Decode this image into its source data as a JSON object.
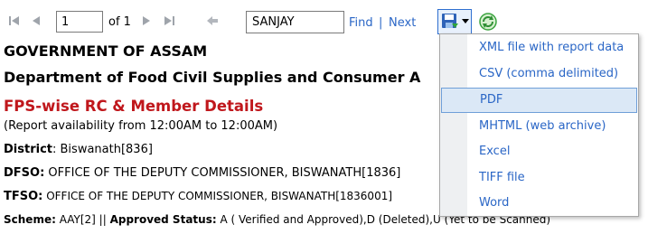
{
  "toolbar": {
    "page_value": "1",
    "of_text": "of 1",
    "search_value": "SANJAY",
    "find_label": "Find",
    "separator": "|",
    "next_label": "Next"
  },
  "report": {
    "title_line1": "GOVERNMENT OF ASSAM",
    "title_line2": "Department of Food  Civil Supplies and Consumer A",
    "report_title": "FPS-wise RC & Member Details",
    "availability": "(Report availability from 12:00AM to 12:00AM)",
    "district_label": "District",
    "district_value": ": Biswanath[836]",
    "dfso_label": "DFSO:",
    "dfso_value": " OFFICE OF THE DEPUTY COMMISSIONER, BISWANATH[1836]",
    "tfso_label": "TFSO:",
    "tfso_value": " OFFICE OF THE DEPUTY COMMISSIONER, BISWANATH[1836001]",
    "scheme_label": "Scheme:",
    "scheme_value": " AAY[2]  || ",
    "approved_label": "Approved Status:",
    "approved_value": "  A ( Verified and Approved),D (Deleted),U (Yet to be Scanned)"
  },
  "export_menu": {
    "items": [
      "XML file with report data",
      "CSV (comma delimited)",
      "PDF",
      "MHTML (web archive)",
      "Excel",
      "TIFF file",
      "Word"
    ],
    "active_index": 2
  },
  "colors": {
    "link": "#2a66c6",
    "report_title": "#c0171c",
    "menu_highlight": "#dbe8f6"
  },
  "icons": [
    "first-page-icon",
    "previous-page-icon",
    "next-page-icon",
    "last-page-icon",
    "back-icon",
    "save-export-icon",
    "refresh-icon"
  ]
}
